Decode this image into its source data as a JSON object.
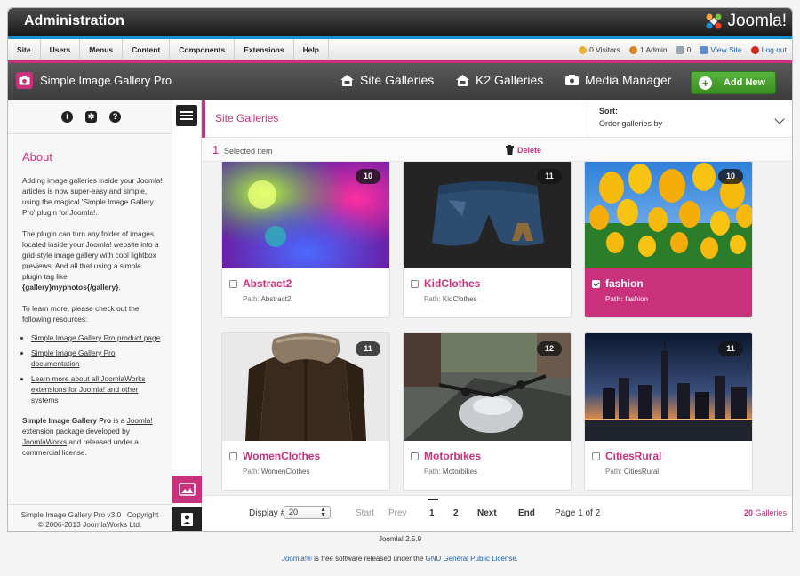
{
  "window": {
    "title": "Administration",
    "brand": "Joomla!"
  },
  "menu": {
    "items": [
      "Site",
      "Users",
      "Menus",
      "Content",
      "Components",
      "Extensions",
      "Help"
    ]
  },
  "status": {
    "visitors": "0 Visitors",
    "admins": "1 Admin",
    "messages": "0",
    "view_site": "View Site",
    "logout": "Log out"
  },
  "toolbar": {
    "app_name": "Simple Image Gallery Pro",
    "nav": [
      "Site Galleries",
      "K2 Galleries",
      "Media Manager"
    ],
    "add_new": "Add New"
  },
  "sidebar": {
    "about_heading": "About",
    "p1": "Adding image galleries inside your Joomla! articles is now super-easy and simple, using the magical 'Simple Image Gallery Pro' plugin for Joomla!.",
    "p2_a": "The plugin can turn any folder of images located inside your Joomla! website into a grid-style image gallery with cool lightbox previews. And all that using a simple plugin tag like ",
    "p2_tag": "{gallery}myphotos{/gallery}",
    "p2_b": ".",
    "p3": "To learn more, please check out the following resources:",
    "links": [
      "Simple Image Gallery Pro product page",
      "Simple Image Gallery Pro documentation",
      "Learn more about all JoomlaWorks extensions for Joomla! and other systems"
    ],
    "p4_name": "Simple Image Gallery Pro",
    "p4_a": " is a ",
    "p4_joomla": "Joomla!",
    "p4_b": " extension package developed by ",
    "p4_jw": "JoomlaWorks",
    "p4_c": " and released under a commercial license.",
    "footer_1": "Simple Image Gallery Pro v3.0 | Copyright",
    "footer_2": "© 2006-2013 JoomlaWorks Ltd."
  },
  "content": {
    "heading": "Site Galleries",
    "sort_label": "Sort:",
    "sort_value": "Order galleries by",
    "selected_count": "1",
    "selected_label": "Selected item",
    "delete_label": "Delete"
  },
  "galleries": [
    {
      "name": "Abstract2",
      "path_label": "Path:",
      "path": "Abstract2",
      "count": "10",
      "selected": false
    },
    {
      "name": "KidClothes",
      "path_label": "Path:",
      "path": "KidClothes",
      "count": "11",
      "selected": false
    },
    {
      "name": "fashion",
      "path_label": "Path:",
      "path": "fashion",
      "count": "10",
      "selected": true
    },
    {
      "name": "WomenClothes",
      "path_label": "Path:",
      "path": "WomenClothes",
      "count": "11",
      "selected": false
    },
    {
      "name": "Motorbikes",
      "path_label": "Path:",
      "path": "Motorbikes",
      "count": "12",
      "selected": false
    },
    {
      "name": "CitiesRural",
      "path_label": "Path:",
      "path": "CitiesRural",
      "count": "11",
      "selected": false
    }
  ],
  "pager": {
    "display_label": "Display #",
    "display_value": "20",
    "start": "Start",
    "prev": "Prev",
    "page1": "1",
    "page2": "2",
    "next": "Next",
    "end": "End",
    "page_info": "Page 1 of 2",
    "total_count": "20",
    "total_label": "Galleries"
  },
  "footer": {
    "version": "Joomla! 2.5.9",
    "license_a": "Joomla!®",
    "license_b": " is free software released under the ",
    "license_c": "GNU General Public License",
    "license_d": "."
  },
  "colors": {
    "accent": "#c9317c",
    "blue_bar": "#1a8fd2",
    "add_new_green": "#4aa830"
  }
}
